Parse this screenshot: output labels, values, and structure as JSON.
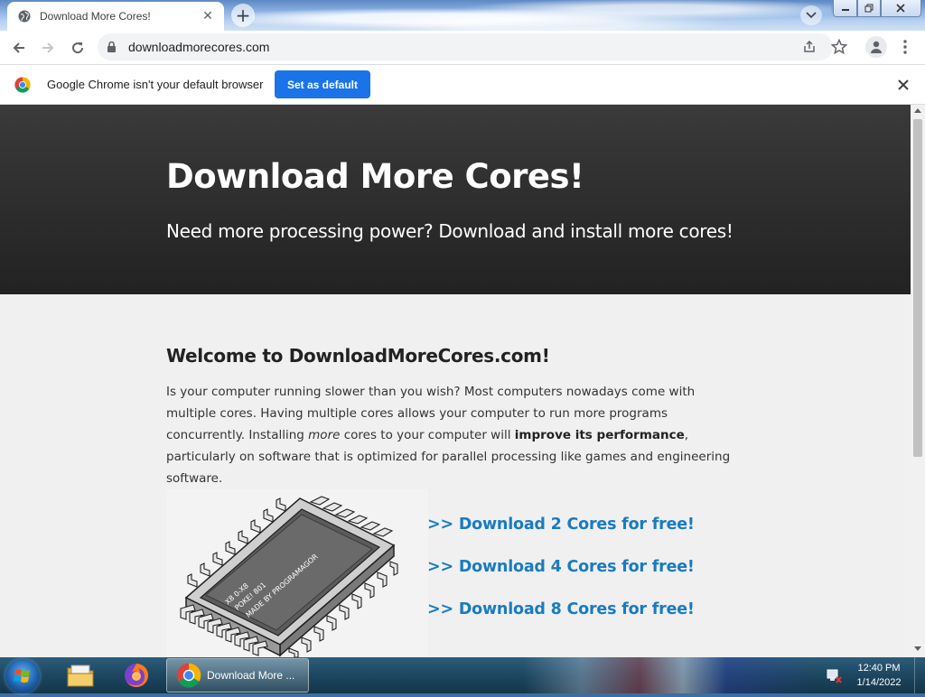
{
  "browser": {
    "tab_title": "Download More Cores!",
    "url": "downloadmorecores.com",
    "infobar_message": "Google Chrome isn't your default browser",
    "set_default_label": "Set as default"
  },
  "page": {
    "hero_title": "Download More Cores!",
    "hero_subtitle": "Need more processing power? Download and install more cores!",
    "welcome_heading": "Welcome to DownloadMoreCores.com!",
    "intro_1": "Is your computer running slower than you wish? Most computers nowadays come with multiple cores. Having multiple cores allows your computer to run more programs concurrently. Installing ",
    "intro_em": "more",
    "intro_2": " cores to your computer will ",
    "intro_strong": "improve its performance",
    "intro_3": ", particularly on software that is optimized for parallel processing like games and engineering software.",
    "chip_text_1": "X8 0-X8",
    "chip_text_2": "POKE! 801",
    "chip_text_3": "MADE BY PROGRAMAGOR",
    "download_links": [
      ">> Download 2 Cores for free!",
      ">> Download 4 Cores for free!",
      ">> Download 8 Cores for free!"
    ]
  },
  "taskbar": {
    "chrome_label": "Download More ...",
    "time": "12:40 PM",
    "date": "1/14/2022"
  },
  "colors": {
    "link": "#1a7bbf",
    "accent_button": "#1a73e8",
    "hero_bg": "#2b2b2b"
  }
}
